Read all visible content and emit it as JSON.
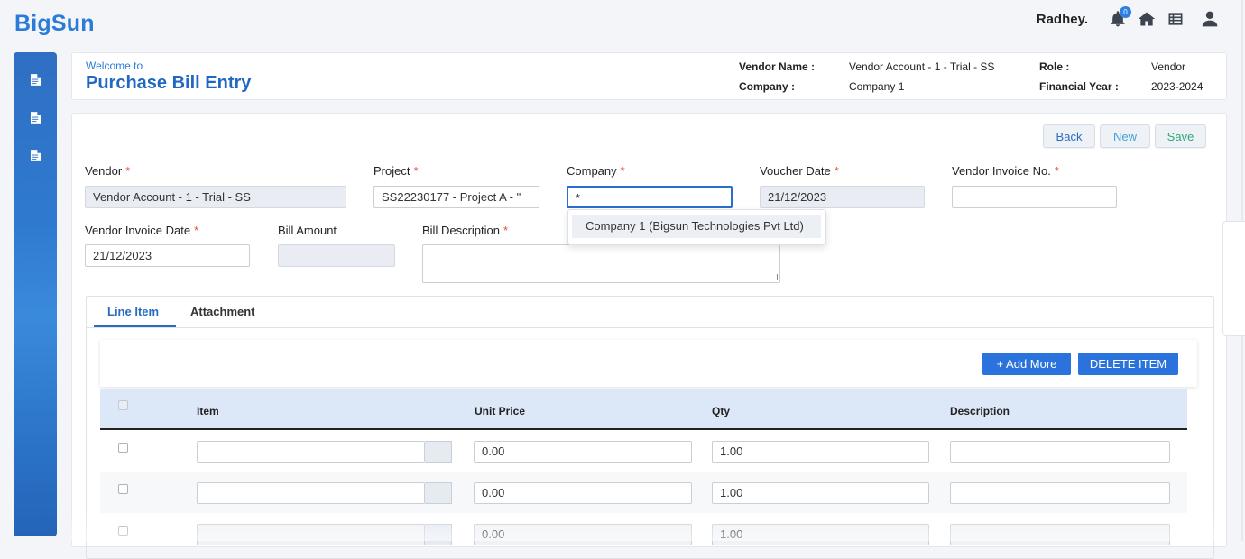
{
  "app": {
    "logo": "BigSun"
  },
  "topbar": {
    "username": "Radhey.",
    "notification_count": "0",
    "icons": [
      "bell-icon",
      "home-icon",
      "list-icon",
      "user-icon"
    ]
  },
  "sidebar": {
    "items": [
      {
        "icon": "document-icon"
      },
      {
        "icon": "document-icon"
      },
      {
        "icon": "document-icon"
      }
    ]
  },
  "header": {
    "welcome": "Welcome to",
    "title": "Purchase Bill Entry",
    "vendor_name_label": "Vendor Name :",
    "vendor_name_value": "Vendor Account - 1 - Trial - SS",
    "company_label": "Company :",
    "company_value": "Company 1",
    "role_label": "Role :",
    "role_value": "Vendor",
    "fy_label": "Financial Year :",
    "fy_value": "2023-2024"
  },
  "toolbar": {
    "back": "Back",
    "new": "New",
    "save": "Save"
  },
  "form": {
    "vendor": {
      "label": "Vendor",
      "value": "Vendor Account - 1 - Trial - SS"
    },
    "project": {
      "label": "Project",
      "value": "SS22230177 - Project A - \""
    },
    "company": {
      "label": "Company",
      "value": "*"
    },
    "company_dropdown": {
      "option": "Company 1 (Bigsun Technologies Pvt Ltd)"
    },
    "voucher_date": {
      "label": "Voucher Date",
      "value": "21/12/2023"
    },
    "vendor_invoice_no": {
      "label": "Vendor Invoice No.",
      "value": ""
    },
    "vendor_invoice_date": {
      "label": "Vendor Invoice Date",
      "value": "21/12/2023"
    },
    "bill_amount": {
      "label": "Bill Amount",
      "value": ""
    },
    "bill_description": {
      "label": "Bill Description",
      "value": ""
    }
  },
  "tabs": [
    {
      "label": "Line Item",
      "active": true
    },
    {
      "label": "Attachment",
      "active": false
    }
  ],
  "line_items": {
    "add_more": "+ Add More",
    "delete_item": "DELETE ITEM",
    "columns": [
      "Item",
      "Unit Price",
      "Qty",
      "Description"
    ],
    "rows": [
      {
        "item": "",
        "unit_price": "0.00",
        "qty": "1.00",
        "description": ""
      },
      {
        "item": "",
        "unit_price": "0.00",
        "qty": "1.00",
        "description": ""
      },
      {
        "item": "",
        "unit_price": "0.00",
        "qty": "1.00",
        "description": ""
      }
    ]
  },
  "colors": {
    "accent": "#2b7bd8",
    "primary_button": "#2a73dc",
    "required": "#e74c3c"
  }
}
